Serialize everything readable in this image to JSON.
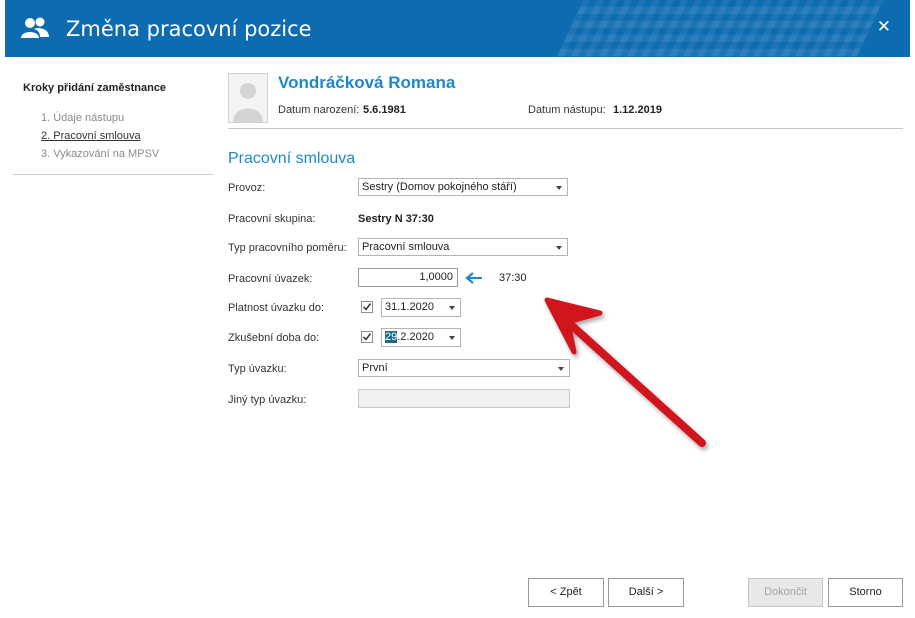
{
  "window": {
    "title": "Změna pracovní pozice",
    "close_label": "✕"
  },
  "steps": {
    "title": "Kroky přidání zaměstnance",
    "items": [
      {
        "label": "1. Údaje nástupu"
      },
      {
        "label": "2. Pracovní smlouva"
      },
      {
        "label": "3. Vykazování na MPSV"
      }
    ]
  },
  "employee": {
    "name": "Vondráčková Romana",
    "birth_label": "Datum narození:",
    "birth_value": "5.6.1981",
    "start_label": "Datum nástupu:",
    "start_value": "1.12.2019"
  },
  "form": {
    "section_title": "Pracovní smlouva",
    "provoz_label": "Provoz:",
    "provoz_value": "Sestry (Domov pokojného stáří)",
    "skupina_label": "Pracovní skupina:",
    "skupina_value": "Sestry N 37:30",
    "typ_pomeru_label": "Typ pracovního poměru:",
    "typ_pomeru_value": "Pracovní smlouva",
    "uvazek_label": "Pracovní úvazek:",
    "uvazek_value": "1,0000",
    "uvazek_hours": "37:30",
    "platnost_label": "Platnost úvazku do:",
    "platnost_checked": true,
    "platnost_value": "31.1.2020",
    "zkusebni_label": "Zkušební doba do:",
    "zkusebni_checked": true,
    "zkusebni_value_selected": "29",
    "zkusebni_value_rest": ".2.2020",
    "typ_uvazku_label": "Typ úvazku:",
    "typ_uvazku_value": "První",
    "jiny_typ_label": "Jiný typ úvazku:",
    "jiny_typ_value": ""
  },
  "buttons": {
    "back": "< Zpět",
    "next": "Další >",
    "finish": "Dokončit",
    "cancel": "Storno"
  },
  "colors": {
    "titlebar": "#0d6bb0",
    "accent": "#1e88c8",
    "annotation_arrow": "#d0121b"
  },
  "icons": {
    "window": "users-icon",
    "avatar": "user-silhouette-icon",
    "hours_link": "arrow-left-icon",
    "checkbox": "checkmark-icon",
    "annotation": "red-arrow-icon"
  }
}
